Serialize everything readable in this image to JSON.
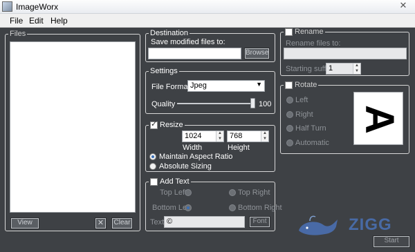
{
  "app": {
    "title": "ImageWorx",
    "close_glyph": "✕"
  },
  "menu": {
    "file": "File",
    "edit": "Edit",
    "help": "Help"
  },
  "files": {
    "legend": "Files",
    "view_label": "View",
    "remove_glyph": "✕",
    "clear_label": "Clear"
  },
  "destination": {
    "legend": "Destination",
    "save_label": "Save modified files to:",
    "path_value": "",
    "browse_label": "Browse"
  },
  "settings": {
    "legend": "Settings",
    "file_format_label": "File Format",
    "file_format_value": "Jpeg",
    "quality_label": "Quality",
    "quality_value": "100",
    "quality_level": 1.0
  },
  "resize": {
    "legend": "Resize",
    "enabled": true,
    "width_value": "1024",
    "height_value": "768",
    "width_label": "Width",
    "height_label": "Height",
    "maintain_label": "Maintain Aspect Ratio",
    "absolute_label": "Absolute Sizing"
  },
  "add_text": {
    "legend": "Add Text",
    "top_left": "Top Left",
    "top_right": "Top Right",
    "bottom_left": "Bottom Left",
    "bottom_right": "Bottom Right",
    "text_label": "Text:",
    "text_value": "©",
    "font_label": "Font"
  },
  "rename": {
    "legend": "Rename",
    "rename_files_label": "Rename files to:",
    "rename_value": "",
    "starting_suffix_label": "Starting suffix:",
    "suffix_value": "1"
  },
  "rotate": {
    "legend": "Rotate",
    "left": "Left",
    "right": "Right",
    "half_turn": "Half Turn",
    "automatic": "Automatic",
    "preview_letter": "A"
  },
  "start_label": "Start",
  "watermark": {
    "text": "ZIGG"
  },
  "colors": {
    "background": "#3e4145",
    "accent_radio": "#3a6fb5",
    "watermark_blue": "#4a6fb0"
  }
}
